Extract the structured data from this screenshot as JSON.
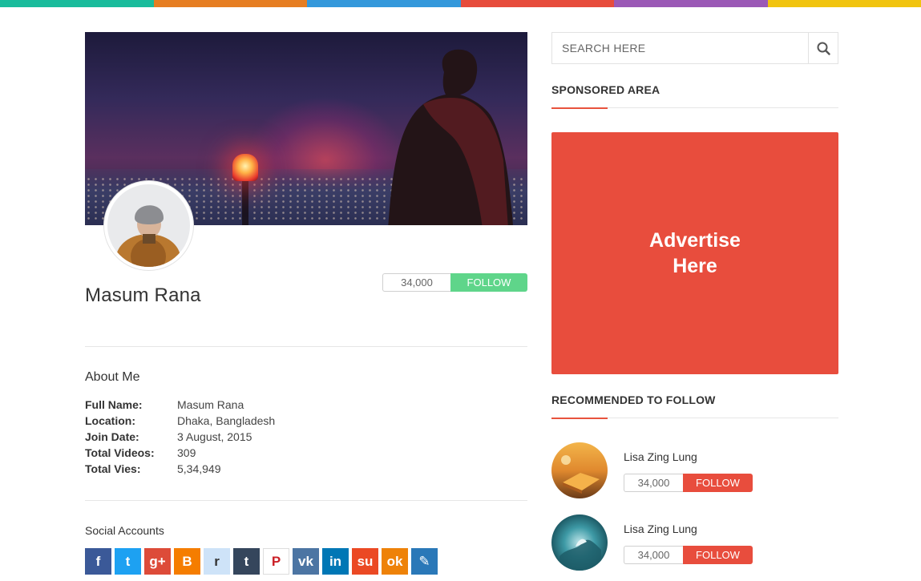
{
  "colors": {
    "topbar": [
      "#1abc9c",
      "#e67e22",
      "#3498db",
      "#e74c3c",
      "#9b59b6",
      "#f1c40f"
    ],
    "follow_green": "#5fd58a",
    "accent_red": "#e84d3d"
  },
  "profile": {
    "name": "Masum Rana",
    "follower_count": "34,000",
    "follow_label": "FOLLOW",
    "avatar_icon": "user-avatar-photo",
    "cover_icon": "cover-photo"
  },
  "about": {
    "title": "About Me",
    "fields": [
      {
        "label": "Full Name:",
        "value": "Masum Rana"
      },
      {
        "label": "Location:",
        "value": "Dhaka, Bangladesh"
      },
      {
        "label": "Join Date:",
        "value": "3 August, 2015"
      },
      {
        "label": "Total Videos:",
        "value": "309"
      },
      {
        "label": "Total Vies:",
        "value": "5,34,949"
      }
    ]
  },
  "social": {
    "title": "Social Accounts",
    "accounts": [
      {
        "name": "facebook",
        "icon": "facebook-icon",
        "glyph": "f",
        "color": "#3b5998"
      },
      {
        "name": "twitter",
        "icon": "twitter-icon",
        "glyph": "t",
        "color": "#1da1f2"
      },
      {
        "name": "google-plus",
        "icon": "google-plus-icon",
        "glyph": "g+",
        "color": "#dd4b39"
      },
      {
        "name": "blogger",
        "icon": "blogger-icon",
        "glyph": "B",
        "color": "#f57d00"
      },
      {
        "name": "reddit",
        "icon": "reddit-icon",
        "glyph": "r",
        "color": "#cee3f8"
      },
      {
        "name": "tumblr",
        "icon": "tumblr-icon",
        "glyph": "t",
        "color": "#35465c"
      },
      {
        "name": "pinterest",
        "icon": "pinterest-icon",
        "glyph": "P",
        "color": "#ffffff"
      },
      {
        "name": "vk",
        "icon": "vk-icon",
        "glyph": "vk",
        "color": "#4c75a3"
      },
      {
        "name": "linkedin",
        "icon": "linkedin-icon",
        "glyph": "in",
        "color": "#0077b5"
      },
      {
        "name": "stumbleupon",
        "icon": "stumbleupon-icon",
        "glyph": "su",
        "color": "#eb4924"
      },
      {
        "name": "odnoklassniki",
        "icon": "odnoklassniki-icon",
        "glyph": "ok",
        "color": "#ee8208"
      },
      {
        "name": "livejournal",
        "icon": "livejournal-icon",
        "glyph": "✎",
        "color": "#2a78b8"
      }
    ]
  },
  "search": {
    "placeholder": "SEARCH HERE",
    "icon": "search-icon"
  },
  "sponsored": {
    "title": "SPONSORED AREA",
    "ad_text": "Advertise Here"
  },
  "recommended": {
    "title": "RECOMMENDED TO FOLLOW",
    "users": [
      {
        "name": "Lisa Zing Lung",
        "count": "34,000",
        "follow_label": "FOLLOW"
      },
      {
        "name": "Lisa Zing Lung",
        "count": "34,000",
        "follow_label": "FOLLOW"
      }
    ]
  }
}
